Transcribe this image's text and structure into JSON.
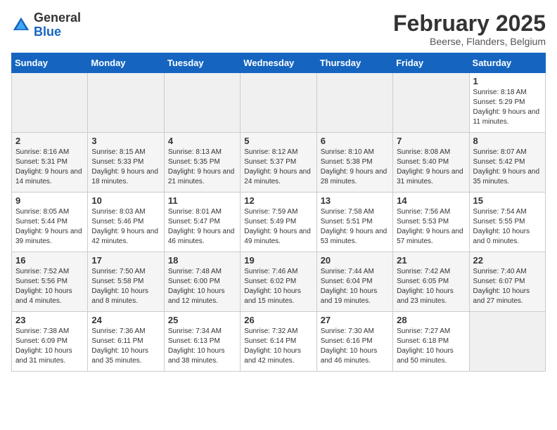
{
  "header": {
    "logo_general": "General",
    "logo_blue": "Blue",
    "month_title": "February 2025",
    "subtitle": "Beerse, Flanders, Belgium"
  },
  "days_of_week": [
    "Sunday",
    "Monday",
    "Tuesday",
    "Wednesday",
    "Thursday",
    "Friday",
    "Saturday"
  ],
  "weeks": [
    [
      {
        "day": "",
        "info": ""
      },
      {
        "day": "",
        "info": ""
      },
      {
        "day": "",
        "info": ""
      },
      {
        "day": "",
        "info": ""
      },
      {
        "day": "",
        "info": ""
      },
      {
        "day": "",
        "info": ""
      },
      {
        "day": "1",
        "info": "Sunrise: 8:18 AM\nSunset: 5:29 PM\nDaylight: 9 hours and 11 minutes."
      }
    ],
    [
      {
        "day": "2",
        "info": "Sunrise: 8:16 AM\nSunset: 5:31 PM\nDaylight: 9 hours and 14 minutes."
      },
      {
        "day": "3",
        "info": "Sunrise: 8:15 AM\nSunset: 5:33 PM\nDaylight: 9 hours and 18 minutes."
      },
      {
        "day": "4",
        "info": "Sunrise: 8:13 AM\nSunset: 5:35 PM\nDaylight: 9 hours and 21 minutes."
      },
      {
        "day": "5",
        "info": "Sunrise: 8:12 AM\nSunset: 5:37 PM\nDaylight: 9 hours and 24 minutes."
      },
      {
        "day": "6",
        "info": "Sunrise: 8:10 AM\nSunset: 5:38 PM\nDaylight: 9 hours and 28 minutes."
      },
      {
        "day": "7",
        "info": "Sunrise: 8:08 AM\nSunset: 5:40 PM\nDaylight: 9 hours and 31 minutes."
      },
      {
        "day": "8",
        "info": "Sunrise: 8:07 AM\nSunset: 5:42 PM\nDaylight: 9 hours and 35 minutes."
      }
    ],
    [
      {
        "day": "9",
        "info": "Sunrise: 8:05 AM\nSunset: 5:44 PM\nDaylight: 9 hours and 39 minutes."
      },
      {
        "day": "10",
        "info": "Sunrise: 8:03 AM\nSunset: 5:46 PM\nDaylight: 9 hours and 42 minutes."
      },
      {
        "day": "11",
        "info": "Sunrise: 8:01 AM\nSunset: 5:47 PM\nDaylight: 9 hours and 46 minutes."
      },
      {
        "day": "12",
        "info": "Sunrise: 7:59 AM\nSunset: 5:49 PM\nDaylight: 9 hours and 49 minutes."
      },
      {
        "day": "13",
        "info": "Sunrise: 7:58 AM\nSunset: 5:51 PM\nDaylight: 9 hours and 53 minutes."
      },
      {
        "day": "14",
        "info": "Sunrise: 7:56 AM\nSunset: 5:53 PM\nDaylight: 9 hours and 57 minutes."
      },
      {
        "day": "15",
        "info": "Sunrise: 7:54 AM\nSunset: 5:55 PM\nDaylight: 10 hours and 0 minutes."
      }
    ],
    [
      {
        "day": "16",
        "info": "Sunrise: 7:52 AM\nSunset: 5:56 PM\nDaylight: 10 hours and 4 minutes."
      },
      {
        "day": "17",
        "info": "Sunrise: 7:50 AM\nSunset: 5:58 PM\nDaylight: 10 hours and 8 minutes."
      },
      {
        "day": "18",
        "info": "Sunrise: 7:48 AM\nSunset: 6:00 PM\nDaylight: 10 hours and 12 minutes."
      },
      {
        "day": "19",
        "info": "Sunrise: 7:46 AM\nSunset: 6:02 PM\nDaylight: 10 hours and 15 minutes."
      },
      {
        "day": "20",
        "info": "Sunrise: 7:44 AM\nSunset: 6:04 PM\nDaylight: 10 hours and 19 minutes."
      },
      {
        "day": "21",
        "info": "Sunrise: 7:42 AM\nSunset: 6:05 PM\nDaylight: 10 hours and 23 minutes."
      },
      {
        "day": "22",
        "info": "Sunrise: 7:40 AM\nSunset: 6:07 PM\nDaylight: 10 hours and 27 minutes."
      }
    ],
    [
      {
        "day": "23",
        "info": "Sunrise: 7:38 AM\nSunset: 6:09 PM\nDaylight: 10 hours and 31 minutes."
      },
      {
        "day": "24",
        "info": "Sunrise: 7:36 AM\nSunset: 6:11 PM\nDaylight: 10 hours and 35 minutes."
      },
      {
        "day": "25",
        "info": "Sunrise: 7:34 AM\nSunset: 6:13 PM\nDaylight: 10 hours and 38 minutes."
      },
      {
        "day": "26",
        "info": "Sunrise: 7:32 AM\nSunset: 6:14 PM\nDaylight: 10 hours and 42 minutes."
      },
      {
        "day": "27",
        "info": "Sunrise: 7:30 AM\nSunset: 6:16 PM\nDaylight: 10 hours and 46 minutes."
      },
      {
        "day": "28",
        "info": "Sunrise: 7:27 AM\nSunset: 6:18 PM\nDaylight: 10 hours and 50 minutes."
      },
      {
        "day": "",
        "info": ""
      }
    ]
  ]
}
